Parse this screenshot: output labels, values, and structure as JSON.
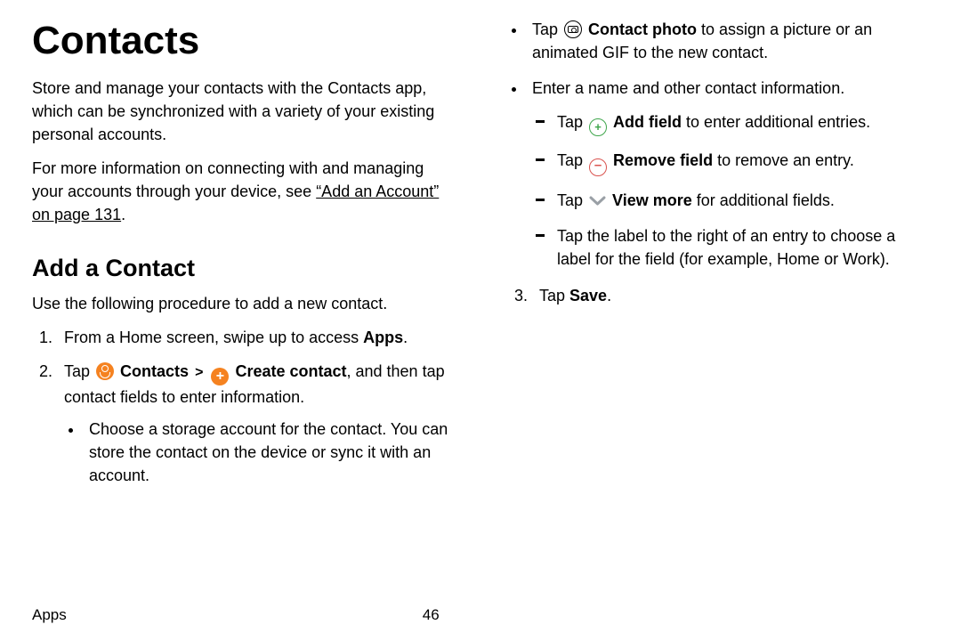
{
  "left": {
    "title": "Contacts",
    "intro1": "Store and manage your contacts with the Contacts app, which can be synchronized with a variety of your existing personal accounts.",
    "intro2_pre": "For more information on connecting with and managing your accounts through your device, see ",
    "intro2_link": "“Add an Account” on page 131",
    "intro2_post": ".",
    "section": "Add a Contact",
    "section_desc": "Use the following procedure to add a new contact.",
    "step1_pre": "From a Home screen, swipe up to access ",
    "step1_bold": "Apps",
    "step1_post": ".",
    "step2_pre": "Tap ",
    "step2_contacts_label": "Contacts",
    "step2_chevron": ">",
    "step2_create_label": "Create contact",
    "step2_post": ", and then tap contact fields to enter information.",
    "step2_bullet1": "Choose a storage account for the contact. You can store the contact on the device or sync it with an account."
  },
  "right": {
    "b1_pre": "Tap ",
    "b1_bold": "Contact photo",
    "b1_post": " to assign a picture or an animated GIF to the new contact.",
    "b2": "Enter a name and other contact information.",
    "d1_pre": "Tap ",
    "d1_bold": "Add field",
    "d1_post": " to enter additional entries.",
    "d2_pre": "Tap ",
    "d2_bold": "Remove field",
    "d2_post": " to remove an entry.",
    "d3_pre": "Tap ",
    "d3_bold": "View more",
    "d3_post": " for additional fields.",
    "d4": "Tap the label to the right of an entry to choose a label for the field (for example, Home or Work).",
    "step3_pre": "Tap ",
    "step3_bold": "Save",
    "step3_post": "."
  },
  "footer": {
    "section": "Apps",
    "page": "46"
  }
}
